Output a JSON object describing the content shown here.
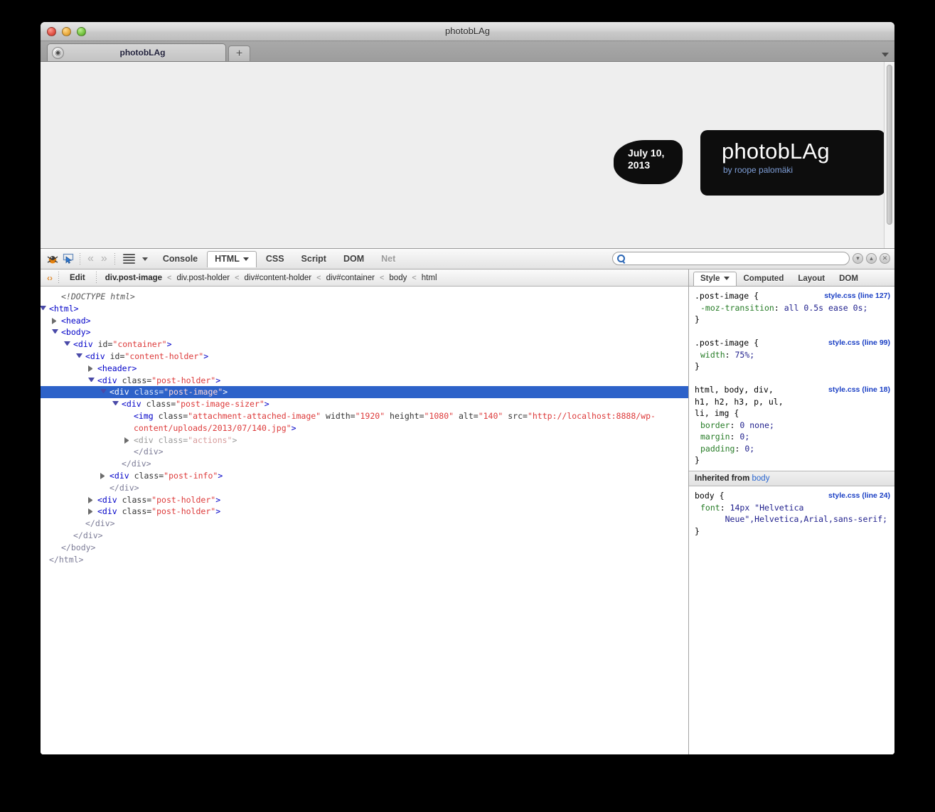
{
  "window": {
    "title": "photobLAg",
    "traffic_lights": [
      "close-button",
      "minimize-button",
      "zoom-button"
    ]
  },
  "tabstrip": {
    "tabs": [
      {
        "title": "photobLAg",
        "favicon": "globe-icon"
      }
    ],
    "new_tab_label": "+",
    "list_all_tabs_icon": "chevron-down-icon"
  },
  "page": {
    "date_badge": "July 10,\n2013",
    "logo_title": "photobLAg",
    "logo_subtitle": "by roope palomäki",
    "logo_bg": "#0d0d0d",
    "logo_subtitle_color": "#7f9fd8"
  },
  "firebug": {
    "toolbar": {
      "icons": [
        "firebug-bug-icon",
        "inspect-element-icon",
        "back-arrow-icon",
        "forward-arrow-icon",
        "panel-menu-icon",
        "options-caret-icon"
      ],
      "tabs": [
        {
          "label": "Console",
          "active": false,
          "dim": false,
          "caret": false
        },
        {
          "label": "HTML",
          "active": true,
          "dim": false,
          "caret": true
        },
        {
          "label": "CSS",
          "active": false,
          "dim": false,
          "caret": false
        },
        {
          "label": "Script",
          "active": false,
          "dim": false,
          "caret": false
        },
        {
          "label": "DOM",
          "active": false,
          "dim": false,
          "caret": false
        },
        {
          "label": "Net",
          "active": false,
          "dim": true,
          "caret": false
        }
      ],
      "search_value": "",
      "search_placeholder": "",
      "search_buttons": [
        "find-next-icon",
        "find-previous-icon",
        "clear-search-icon"
      ]
    },
    "breadcrumb": {
      "edit_label": "Edit",
      "items": [
        {
          "label": "div.post-image",
          "current": true
        },
        {
          "label": "div.post-holder",
          "current": false
        },
        {
          "label": "div#content-holder",
          "current": false
        },
        {
          "label": "div#container",
          "current": false
        },
        {
          "label": "body",
          "current": false
        },
        {
          "label": "html",
          "current": false
        }
      ],
      "separator": "<"
    },
    "dom_tree": [
      {
        "indent": 1,
        "twisty": "none",
        "kind": "doctype",
        "text": "<!DOCTYPE html>"
      },
      {
        "indent": 0,
        "twisty": "open",
        "kind": "tag",
        "tag": "<html>"
      },
      {
        "indent": 1,
        "twisty": "closed",
        "kind": "tag",
        "tag": "<head>"
      },
      {
        "indent": 1,
        "twisty": "open",
        "kind": "tag",
        "tag": "<body>"
      },
      {
        "indent": 2,
        "twisty": "open",
        "kind": "el",
        "tag": "<div ",
        "attr": "id=",
        "val": "\"container\"",
        "end": ">"
      },
      {
        "indent": 3,
        "twisty": "open",
        "kind": "el",
        "tag": "<div ",
        "attr": "id=",
        "val": "\"content-holder\"",
        "end": ">"
      },
      {
        "indent": 4,
        "twisty": "closed",
        "kind": "tag",
        "tag": "<header>"
      },
      {
        "indent": 4,
        "twisty": "open",
        "kind": "el",
        "tag": "<div ",
        "attr": "class=",
        "val": "\"post-holder\"",
        "end": ">"
      },
      {
        "indent": 5,
        "twisty": "open",
        "kind": "el",
        "selected": true,
        "tag": "<div ",
        "attr": "class=",
        "val": "\"post-image\"",
        "end": ">"
      },
      {
        "indent": 6,
        "twisty": "open",
        "kind": "el",
        "tag": "<div ",
        "attr": "class=",
        "val": "\"post-image-sizer\"",
        "end": ">"
      },
      {
        "indent": 7,
        "twisty": "none",
        "kind": "img",
        "tag": "<img ",
        "parts": [
          {
            "t": "attr",
            "v": "class="
          },
          {
            "t": "val",
            "v": "\"attachment-attached-image\""
          },
          {
            "t": "attr",
            "v": " width="
          },
          {
            "t": "val",
            "v": "\"1920\""
          },
          {
            "t": "attr",
            "v": " height="
          },
          {
            "t": "val",
            "v": "\"1080\""
          },
          {
            "t": "attr",
            "v": " alt="
          },
          {
            "t": "val",
            "v": "\"140\""
          },
          {
            "t": "attr",
            "v": " src="
          },
          {
            "t": "val",
            "v": "\"http://localhost:8888/wp-content/uploads/2013/07/140.jpg\""
          },
          {
            "t": "tag",
            "v": ">"
          }
        ]
      },
      {
        "indent": 7,
        "twisty": "closed",
        "dim": true,
        "kind": "el",
        "tag": "<div ",
        "attr": "class=",
        "val": "\"actions\"",
        "end": ">"
      },
      {
        "indent": 7,
        "twisty": "none",
        "kind": "close",
        "text": "</div>"
      },
      {
        "indent": 6,
        "twisty": "none",
        "kind": "close",
        "text": "</div>"
      },
      {
        "indent": 5,
        "twisty": "closed",
        "kind": "el",
        "tag": "<div ",
        "attr": "class=",
        "val": "\"post-info\"",
        "end": ">"
      },
      {
        "indent": 5,
        "twisty": "none",
        "kind": "close",
        "text": "</div>"
      },
      {
        "indent": 4,
        "twisty": "closed",
        "kind": "el",
        "tag": "<div ",
        "attr": "class=",
        "val": "\"post-holder\"",
        "end": ">"
      },
      {
        "indent": 4,
        "twisty": "closed",
        "kind": "el",
        "tag": "<div ",
        "attr": "class=",
        "val": "\"post-holder\"",
        "end": ">"
      },
      {
        "indent": 3,
        "twisty": "none",
        "kind": "close",
        "text": "</div>"
      },
      {
        "indent": 2,
        "twisty": "none",
        "kind": "close",
        "text": "</div>"
      },
      {
        "indent": 1,
        "twisty": "none",
        "kind": "close",
        "text": "</body>"
      },
      {
        "indent": 0,
        "twisty": "none",
        "kind": "close",
        "text": "</html>"
      }
    ],
    "css_panel": {
      "tabs": [
        {
          "label": "Style",
          "active": true,
          "caret": true
        },
        {
          "label": "Computed",
          "active": false,
          "caret": false
        },
        {
          "label": "Layout",
          "active": false,
          "caret": false
        },
        {
          "label": "DOM",
          "active": false,
          "caret": false
        }
      ],
      "rules": [
        {
          "selector": ".post-image {",
          "source": "style.css (line 127)",
          "declarations": [
            {
              "prop": "-moz-transition",
              "value": "all 0.5s ease 0s;"
            }
          ]
        },
        {
          "selector": ".post-image {",
          "source": "style.css (line 99)",
          "declarations": [
            {
              "prop": "width",
              "value": "75%;"
            }
          ]
        },
        {
          "selector": "html, body, div,\nh1, h2, h3, p, ul,\nli, img {",
          "source": "style.css (line 18)",
          "declarations": [
            {
              "prop": "border",
              "value": "0 none;"
            },
            {
              "prop": "margin",
              "value": "0;"
            },
            {
              "prop": "padding",
              "value": "0;"
            }
          ]
        }
      ],
      "inherited_label": "Inherited from",
      "inherited_source": "body",
      "inherited_rules": [
        {
          "selector": "body {",
          "source": "style.css (line 24)",
          "declarations": [
            {
              "prop": "font",
              "value": "14px \"Helvetica\n     Neue\",Helvetica,Arial,sans-serif;"
            }
          ]
        }
      ]
    }
  }
}
